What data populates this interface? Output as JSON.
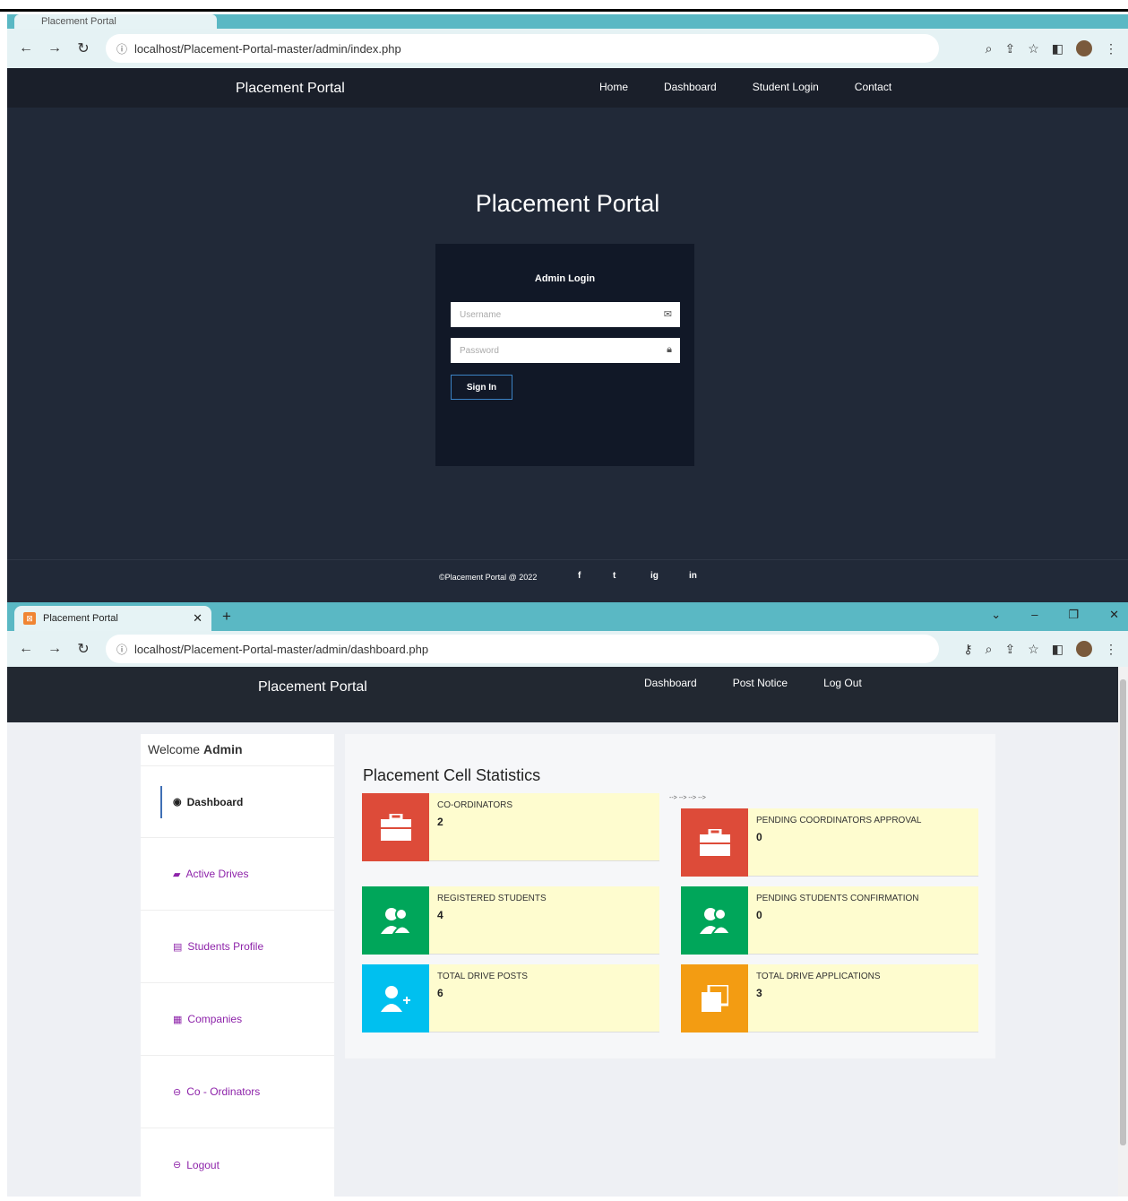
{
  "login_window": {
    "tab_title": "Placement Portal",
    "url": "localhost/Placement-Portal-master/admin/index.php",
    "brand": "Placement Portal",
    "nav": [
      "Home",
      "Dashboard",
      "Student Login",
      "Contact"
    ],
    "hero_title": "Placement Portal",
    "login": {
      "heading": "Admin Login",
      "username_placeholder": "Username",
      "password_placeholder": "Password",
      "signin_label": "Sign In"
    },
    "footer": {
      "copyright": "©Placement Portal @ 2022",
      "social": [
        "f",
        "t",
        "ig",
        "in"
      ]
    }
  },
  "dashboard_window": {
    "tab_title": "Placement Portal",
    "url": "localhost/Placement-Portal-master/admin/dashboard.php",
    "brand": "Placement Portal",
    "nav": [
      "Dashboard",
      "Post Notice",
      "Log Out"
    ],
    "sidebar": {
      "welcome_prefix": "Welcome",
      "welcome_user": "Admin",
      "items": [
        {
          "label": "Dashboard",
          "icon": "dashboard-icon",
          "active": true
        },
        {
          "label": "Active Drives",
          "icon": "briefcase-icon"
        },
        {
          "label": "Students Profile",
          "icon": "id-card-icon"
        },
        {
          "label": "Companies",
          "icon": "building-icon"
        },
        {
          "label": "Co - Ordinators",
          "icon": "arrow-circle-icon"
        },
        {
          "label": "Logout",
          "icon": "arrow-circle-icon"
        }
      ]
    },
    "stats": {
      "title": "Placement Cell Statistics",
      "arrows_note": "--> --> --> -->",
      "cards": [
        {
          "label": "CO-ORDINATORS",
          "value": "2",
          "color": "#dd4b39",
          "icon": "briefcase-icon"
        },
        {
          "label": "PENDING COORDINATORS APPROVAL",
          "value": "0",
          "color": "#dd4b39",
          "icon": "briefcase-icon"
        },
        {
          "label": "REGISTERED STUDENTS",
          "value": "4",
          "color": "#00a65a",
          "icon": "users-icon"
        },
        {
          "label": "PENDING STUDENTS CONFIRMATION",
          "value": "0",
          "color": "#00a65a",
          "icon": "users-icon"
        },
        {
          "label": "TOTAL DRIVE POSTS",
          "value": "6",
          "color": "#00c0ef",
          "icon": "user-plus-icon"
        },
        {
          "label": "TOTAL DRIVE APPLICATIONS",
          "value": "3",
          "color": "#f39c12",
          "icon": "copy-icon"
        }
      ]
    }
  }
}
